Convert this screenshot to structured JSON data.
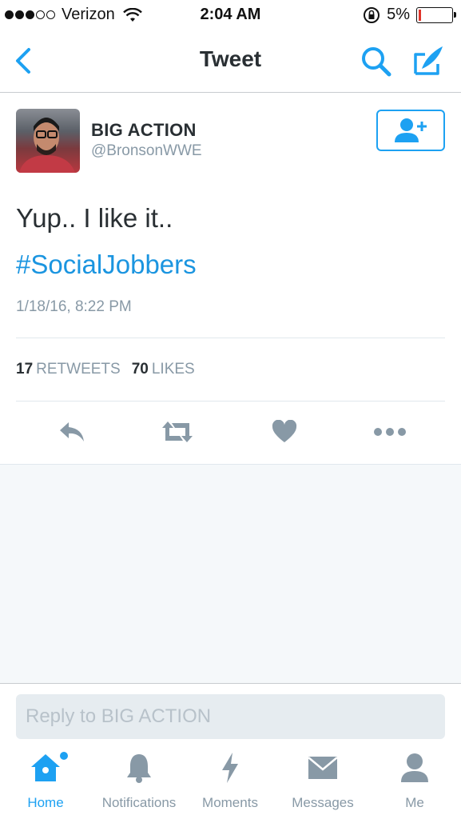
{
  "status_bar": {
    "carrier": "Verizon",
    "time": "2:04 AM",
    "battery_percent": "5%",
    "battery_level": 0.05
  },
  "nav": {
    "title": "Tweet",
    "icons": [
      "back-chevron-icon",
      "search-icon",
      "compose-icon"
    ]
  },
  "tweet": {
    "display_name": "BIG ACTION",
    "handle": "@BronsonWWE",
    "text": "Yup.. I like it..",
    "hashtag": "#SocialJobbers",
    "timestamp": "1/18/16, 8:22 PM",
    "retweets_count": "17",
    "retweets_label": "RETWEETS",
    "likes_count": "70",
    "likes_label": "LIKES"
  },
  "actions": [
    "reply-icon",
    "retweet-icon",
    "like-icon",
    "more-icon"
  ],
  "reply": {
    "placeholder": "Reply to BIG ACTION"
  },
  "tabbar": {
    "tabs": [
      {
        "label": "Home",
        "icon": "home-icon",
        "active": true
      },
      {
        "label": "Notifications",
        "icon": "bell-icon",
        "active": false
      },
      {
        "label": "Moments",
        "icon": "lightning-icon",
        "active": false
      },
      {
        "label": "Messages",
        "icon": "envelope-icon",
        "active": false
      },
      {
        "label": "Me",
        "icon": "person-icon",
        "active": false
      }
    ]
  },
  "colors": {
    "accent": "#1da1f2",
    "link": "#1b95e0",
    "muted": "#8899a6",
    "text": "#292f33",
    "battery_low": "#e0352b"
  }
}
